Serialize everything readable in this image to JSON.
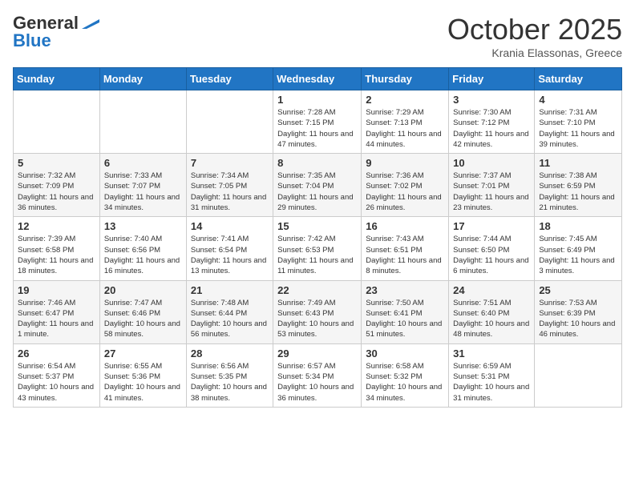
{
  "header": {
    "logo_general": "General",
    "logo_blue": "Blue",
    "month_title": "October 2025",
    "subtitle": "Krania Elassonas, Greece"
  },
  "days_of_week": [
    "Sunday",
    "Monday",
    "Tuesday",
    "Wednesday",
    "Thursday",
    "Friday",
    "Saturday"
  ],
  "weeks": [
    [
      {
        "day": "",
        "info": ""
      },
      {
        "day": "",
        "info": ""
      },
      {
        "day": "",
        "info": ""
      },
      {
        "day": "1",
        "info": "Sunrise: 7:28 AM\nSunset: 7:15 PM\nDaylight: 11 hours and 47 minutes."
      },
      {
        "day": "2",
        "info": "Sunrise: 7:29 AM\nSunset: 7:13 PM\nDaylight: 11 hours and 44 minutes."
      },
      {
        "day": "3",
        "info": "Sunrise: 7:30 AM\nSunset: 7:12 PM\nDaylight: 11 hours and 42 minutes."
      },
      {
        "day": "4",
        "info": "Sunrise: 7:31 AM\nSunset: 7:10 PM\nDaylight: 11 hours and 39 minutes."
      }
    ],
    [
      {
        "day": "5",
        "info": "Sunrise: 7:32 AM\nSunset: 7:09 PM\nDaylight: 11 hours and 36 minutes."
      },
      {
        "day": "6",
        "info": "Sunrise: 7:33 AM\nSunset: 7:07 PM\nDaylight: 11 hours and 34 minutes."
      },
      {
        "day": "7",
        "info": "Sunrise: 7:34 AM\nSunset: 7:05 PM\nDaylight: 11 hours and 31 minutes."
      },
      {
        "day": "8",
        "info": "Sunrise: 7:35 AM\nSunset: 7:04 PM\nDaylight: 11 hours and 29 minutes."
      },
      {
        "day": "9",
        "info": "Sunrise: 7:36 AM\nSunset: 7:02 PM\nDaylight: 11 hours and 26 minutes."
      },
      {
        "day": "10",
        "info": "Sunrise: 7:37 AM\nSunset: 7:01 PM\nDaylight: 11 hours and 23 minutes."
      },
      {
        "day": "11",
        "info": "Sunrise: 7:38 AM\nSunset: 6:59 PM\nDaylight: 11 hours and 21 minutes."
      }
    ],
    [
      {
        "day": "12",
        "info": "Sunrise: 7:39 AM\nSunset: 6:58 PM\nDaylight: 11 hours and 18 minutes."
      },
      {
        "day": "13",
        "info": "Sunrise: 7:40 AM\nSunset: 6:56 PM\nDaylight: 11 hours and 16 minutes."
      },
      {
        "day": "14",
        "info": "Sunrise: 7:41 AM\nSunset: 6:54 PM\nDaylight: 11 hours and 13 minutes."
      },
      {
        "day": "15",
        "info": "Sunrise: 7:42 AM\nSunset: 6:53 PM\nDaylight: 11 hours and 11 minutes."
      },
      {
        "day": "16",
        "info": "Sunrise: 7:43 AM\nSunset: 6:51 PM\nDaylight: 11 hours and 8 minutes."
      },
      {
        "day": "17",
        "info": "Sunrise: 7:44 AM\nSunset: 6:50 PM\nDaylight: 11 hours and 6 minutes."
      },
      {
        "day": "18",
        "info": "Sunrise: 7:45 AM\nSunset: 6:49 PM\nDaylight: 11 hours and 3 minutes."
      }
    ],
    [
      {
        "day": "19",
        "info": "Sunrise: 7:46 AM\nSunset: 6:47 PM\nDaylight: 11 hours and 1 minute."
      },
      {
        "day": "20",
        "info": "Sunrise: 7:47 AM\nSunset: 6:46 PM\nDaylight: 10 hours and 58 minutes."
      },
      {
        "day": "21",
        "info": "Sunrise: 7:48 AM\nSunset: 6:44 PM\nDaylight: 10 hours and 56 minutes."
      },
      {
        "day": "22",
        "info": "Sunrise: 7:49 AM\nSunset: 6:43 PM\nDaylight: 10 hours and 53 minutes."
      },
      {
        "day": "23",
        "info": "Sunrise: 7:50 AM\nSunset: 6:41 PM\nDaylight: 10 hours and 51 minutes."
      },
      {
        "day": "24",
        "info": "Sunrise: 7:51 AM\nSunset: 6:40 PM\nDaylight: 10 hours and 48 minutes."
      },
      {
        "day": "25",
        "info": "Sunrise: 7:53 AM\nSunset: 6:39 PM\nDaylight: 10 hours and 46 minutes."
      }
    ],
    [
      {
        "day": "26",
        "info": "Sunrise: 6:54 AM\nSunset: 5:37 PM\nDaylight: 10 hours and 43 minutes."
      },
      {
        "day": "27",
        "info": "Sunrise: 6:55 AM\nSunset: 5:36 PM\nDaylight: 10 hours and 41 minutes."
      },
      {
        "day": "28",
        "info": "Sunrise: 6:56 AM\nSunset: 5:35 PM\nDaylight: 10 hours and 38 minutes."
      },
      {
        "day": "29",
        "info": "Sunrise: 6:57 AM\nSunset: 5:34 PM\nDaylight: 10 hours and 36 minutes."
      },
      {
        "day": "30",
        "info": "Sunrise: 6:58 AM\nSunset: 5:32 PM\nDaylight: 10 hours and 34 minutes."
      },
      {
        "day": "31",
        "info": "Sunrise: 6:59 AM\nSunset: 5:31 PM\nDaylight: 10 hours and 31 minutes."
      },
      {
        "day": "",
        "info": ""
      }
    ]
  ]
}
